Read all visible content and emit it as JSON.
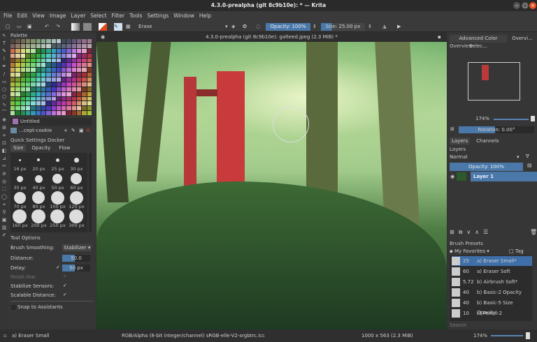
{
  "window": {
    "title": "4.3.0-prealpha (git 8c9b10e):  * — Krita"
  },
  "menu": [
    "File",
    "Edit",
    "View",
    "Image",
    "Layer",
    "Select",
    "Filter",
    "Tools",
    "Settings",
    "Window",
    "Help"
  ],
  "toolbar": {
    "blend_mode": "Erase",
    "opacity": "Opacity: 100%",
    "size": "Size: 25.00 px",
    "size_fill": 0.25
  },
  "document": {
    "tab_title": "4.3.0-prealpha (git 8c9b10e): galteed.jpeg (2.3 MiB) *"
  },
  "palette": {
    "title": "Palette",
    "name": "Untitled",
    "resource": "...cept-cookie"
  },
  "quick_settings": {
    "title": "Quick Settings Docker",
    "tabs": [
      "Size",
      "Opacity",
      "Flow"
    ],
    "sizes": [
      "16 px",
      "20 px",
      "25 px",
      "30 px",
      "35 px",
      "40 px",
      "50 px",
      "60 px",
      "70 px",
      "80 px",
      "100 px",
      "120 px",
      "160 px",
      "200 px",
      "250 px",
      "300 px"
    ]
  },
  "tool_options": {
    "title": "Tool Options",
    "brush_smoothing_label": "Brush Smoothing:",
    "brush_smoothing_value": "Stabilizer",
    "distance_label": "Distance:",
    "distance_value": "50.0",
    "delay_label": "Delay:",
    "delay_value": "50 px",
    "finish_line_label": "Finish line:",
    "stabilize_sensors_label": "Stabilize Sensors:",
    "scalable_distance_label": "Scalable Distance:",
    "snap_label": "Snap to Assistants"
  },
  "right": {
    "tabs": [
      "Advanced Color Selec...",
      "Overvi..."
    ],
    "overview_title": "Overview",
    "zoom": "174%",
    "rotation": "Rotation: 0.00°",
    "layer_tabs": [
      "Layers",
      "Channels"
    ],
    "layers_title": "Layers",
    "blend": "Normal",
    "layer_opacity": "Opacity:  100%",
    "layer_name": "Layer 1",
    "presets_title": "Brush Presets",
    "tag_filter": "My Favorites",
    "tag_label": "Tag",
    "search_placeholder": "Search",
    "presets": [
      {
        "size": "25",
        "name": "a) Eraser Small*"
      },
      {
        "size": "60",
        "name": "a) Eraser Soft"
      },
      {
        "size": "5.72",
        "name": "b) Airbrush Soft*"
      },
      {
        "size": "40",
        "name": "b) Basic-2 Opacity"
      },
      {
        "size": "40",
        "name": "b) Basic-5 Size Opacity"
      },
      {
        "size": "10",
        "name": "c) Pencil-2"
      }
    ]
  },
  "status": {
    "preset": "a) Eraser Small",
    "colorspace": "RGB/Alpha (8-bit integer/channel)  sRGB-elle-V2-srgbtrc.icc",
    "dimensions": "1000 x 563 (2.3 MiB)",
    "zoom": "174%"
  },
  "colors": {
    "accent": "#4a78a8",
    "selected_row": "#3f6fa8",
    "close_button": "#e95420"
  }
}
